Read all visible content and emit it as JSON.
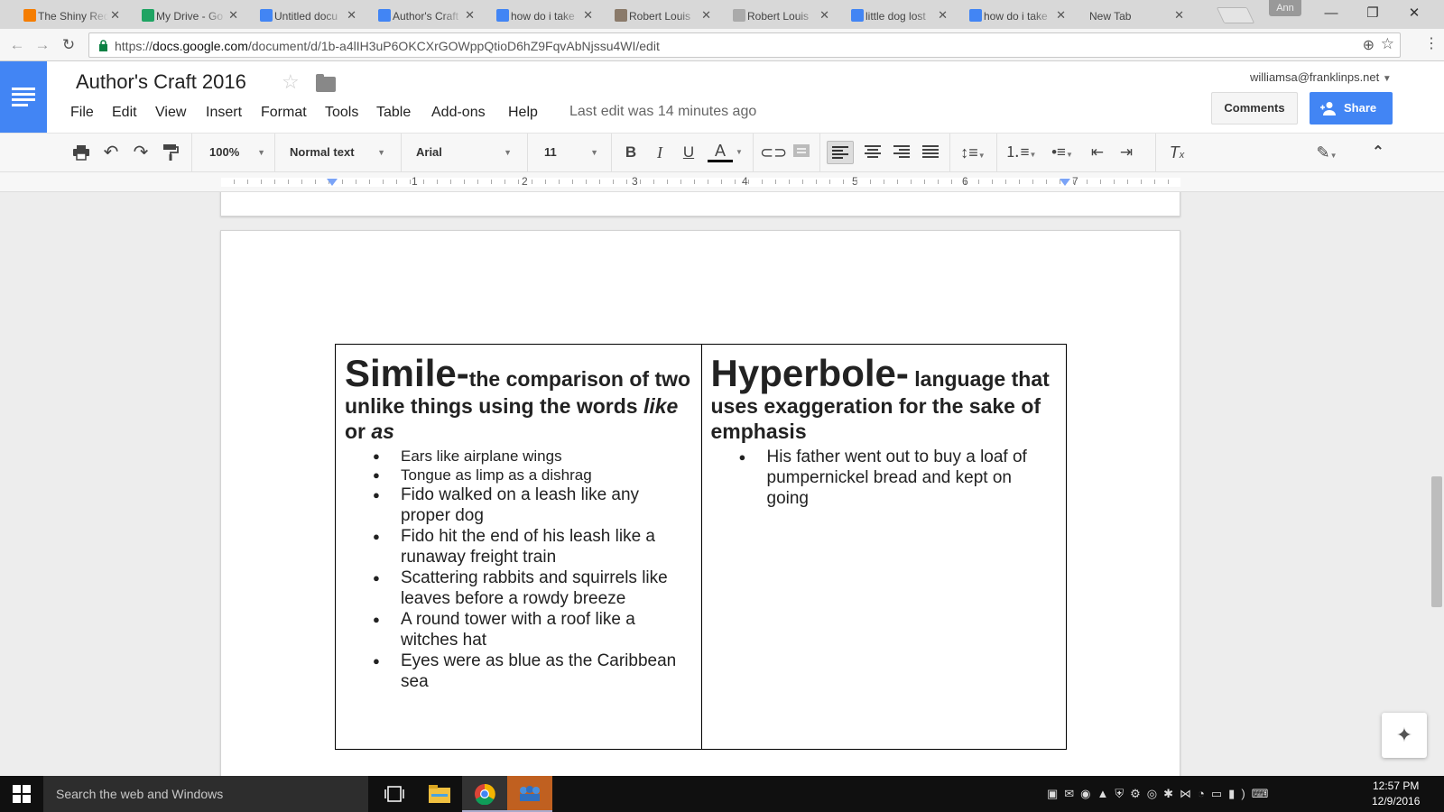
{
  "browser": {
    "tabs": [
      {
        "label": "The Shiny Red",
        "favicon": "blogger-icon",
        "color": "#f57d00"
      },
      {
        "label": "My Drive - Go",
        "favicon": "drive-icon",
        "color": "#1fa463"
      },
      {
        "label": "Untitled docu",
        "favicon": "docs-icon",
        "color": "#4285f4"
      },
      {
        "label": "Author's Craft",
        "favicon": "docs-icon",
        "color": "#4285f4",
        "active": true
      },
      {
        "label": "how do i take",
        "favicon": "google-icon",
        "color": "#4285f4"
      },
      {
        "label": "Robert Louis",
        "favicon": "portrait-icon",
        "color": "#8a7a6a"
      },
      {
        "label": "Robert Louis",
        "favicon": "page-icon",
        "color": "#aaaaaa"
      },
      {
        "label": "little dog lost",
        "favicon": "google-icon",
        "color": "#4285f4"
      },
      {
        "label": "how do i take",
        "favicon": "google-icon",
        "color": "#4285f4"
      },
      {
        "label": "New Tab",
        "favicon": "",
        "color": ""
      }
    ],
    "profile": "Ann",
    "url_prefix": "https://",
    "url_host": "docs.google.com",
    "url_path": "/document/d/1b-a4lIH3uP6OKCXrGOWppQtioD6hZ9FqvAbNjssu4WI/edit"
  },
  "docs": {
    "title": "Author's Craft 2016",
    "menu": [
      "File",
      "Edit",
      "View",
      "Insert",
      "Format",
      "Tools",
      "Table",
      "Add-ons",
      "Help"
    ],
    "last_edit": "Last edit was 14 minutes ago",
    "account": "williamsa@franklinps.net",
    "comments_label": "Comments",
    "share_label": "Share",
    "toolbar": {
      "zoom": "100%",
      "style": "Normal text",
      "font": "Arial",
      "size": "11"
    },
    "ruler": [
      "1",
      "2",
      "3",
      "4",
      "5",
      "6",
      "7"
    ],
    "accent": "#4285f4"
  },
  "document": {
    "left": {
      "term": "Simile-",
      "definition_before": "the comparison of two unlike things using the words ",
      "definition_like": "like",
      "definition_or": " or ",
      "definition_as": "as",
      "examples": [
        "Ears like airplane wings",
        "Tongue as limp as a dishrag",
        "Fido walked on a leash like any proper dog",
        "Fido hit the end of his leash like a runaway freight train",
        "Scattering rabbits and squirrels like leaves before a rowdy breeze",
        "A round tower with a roof like a witches hat",
        "Eyes were as blue as the Caribbean sea"
      ]
    },
    "right": {
      "term": "Hyperbole-",
      "definition": " language that uses exaggeration for the sake of emphasis",
      "examples": [
        "His father went out to buy a loaf of pumpernickel bread and kept on going"
      ]
    }
  },
  "taskbar": {
    "search_placeholder": "Search the web and Windows",
    "time": "12:57 PM",
    "date": "12/9/2016"
  }
}
